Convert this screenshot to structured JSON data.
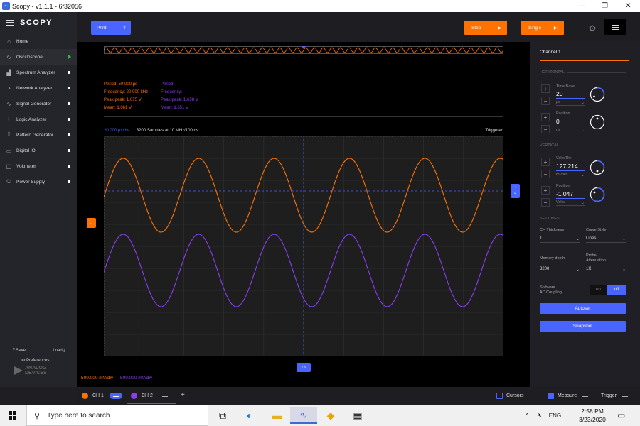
{
  "window": {
    "title": "Scopy - v1.1.1 - 6f32056",
    "minimize": "—",
    "restore": "❐",
    "close": "✕"
  },
  "sidebar": {
    "logo": "SCOPY",
    "items": [
      {
        "label": "Home",
        "icon": "home-icon"
      },
      {
        "label": "Oscilloscope",
        "icon": "oscilloscope-icon",
        "active": true
      },
      {
        "label": "Spectrum Analyzer",
        "icon": "spectrum-icon"
      },
      {
        "label": "Network Analyzer",
        "icon": "network-icon"
      },
      {
        "label": "Signal Generator",
        "icon": "signal-icon"
      },
      {
        "label": "Logic Analyzer",
        "icon": "logic-icon"
      },
      {
        "label": "Pattern Generator",
        "icon": "pattern-icon"
      },
      {
        "label": "Digital IO",
        "icon": "digital-icon"
      },
      {
        "label": "Voltmeter",
        "icon": "voltmeter-icon"
      },
      {
        "label": "Power Supply",
        "icon": "power-icon"
      }
    ],
    "save": "Save",
    "load": "Load",
    "preferences": "Preferences",
    "brand_line1": "ANALOG",
    "brand_line2": "DEVICES"
  },
  "toolbar": {
    "print": "Print",
    "stop": "Stop",
    "single": "Single"
  },
  "measurements": {
    "ch1": {
      "period": "Period:    50.000 µs",
      "frequency": "Frequency: 20.000 kHz",
      "peak_peak": "Peak-peak: 1.675 V",
      "mean": "Mean:      1.061 V"
    },
    "ch2": {
      "period": "Period:    —",
      "frequency": "Frequency: —",
      "peak_peak": "Peak-peak: 1.658 V",
      "mean": "Mean:      1.651 V"
    }
  },
  "plot_info": {
    "timebase": "20.000 µs/div",
    "samples": "3200 Samples at 10 MHz/100 ns",
    "status": "Triggered"
  },
  "scales": {
    "ch1": "500.000 mV/div",
    "ch2": "500.000 mV/div"
  },
  "waveforms": {
    "ch1_color": "#ff7200",
    "ch2_color": "#8a3ef0",
    "cycles": 5.3
  },
  "panel": {
    "title": "Channel 1",
    "horizontal": "HORIZONTAL",
    "time_base_label": "Time Base",
    "time_base_value": "20",
    "time_base_unit": "µs",
    "h_position_label": "Position",
    "h_position_value": "0",
    "h_position_unit": "ns",
    "vertical": "VERTICAL",
    "volts_div_label": "Volts/Div",
    "volts_div_value": "127.214",
    "volts_div_unit": "mVolts",
    "v_position_label": "Position",
    "v_position_value": "-1.047",
    "v_position_unit": "Volts",
    "settings": "SETTINGS",
    "ch_thickness_label": "CH Thickness",
    "ch_thickness_value": "1",
    "curve_style_label": "Curve Style",
    "curve_style_value": "Lines",
    "memory_depth_label": "Memory depth",
    "memory_depth_value": "3200",
    "probe_label_1": "Probe",
    "probe_label_2": "Attenuation",
    "probe_value": "1X",
    "sw_label_1": "Software",
    "sw_label_2": "AC Coupling",
    "toggle_on": "on",
    "toggle_off": "off",
    "autoset": "Autoset",
    "snapshot": "Snapshot"
  },
  "channel_bar": {
    "ch1": "CH 1",
    "ch2": "CH 2",
    "add": "+",
    "cursors": "Cursors",
    "measure": "Measure",
    "trigger": "Trigger"
  },
  "taskbar": {
    "search_placeholder": "Type here to search",
    "lang": "ENG",
    "time": "2:58 PM",
    "date": "3/23/2020"
  }
}
